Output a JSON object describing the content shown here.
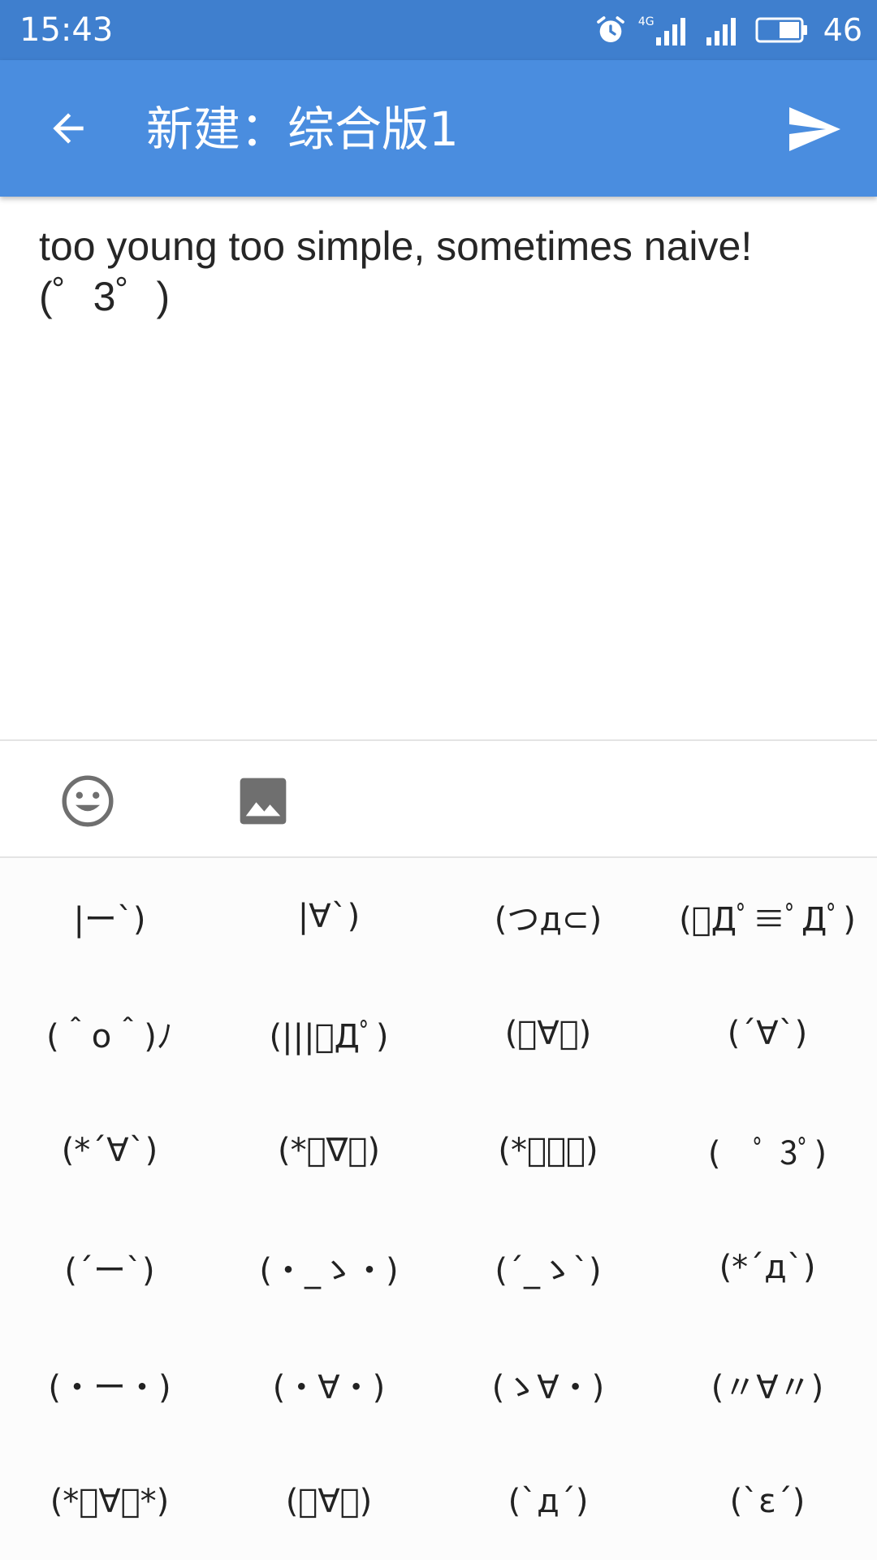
{
  "status_bar": {
    "time": "15:43",
    "network_label": "4G",
    "battery_level": "46",
    "icons": [
      "alarm-icon",
      "signal-icon",
      "signal-icon",
      "battery-icon"
    ]
  },
  "app_bar": {
    "title": "新建：综合版1",
    "back_icon": "arrow-back-icon",
    "send_icon": "send-icon"
  },
  "editor": {
    "lines": [
      "too young too simple, sometimes naive!",
      "(゜3゜)"
    ]
  },
  "toolbar": {
    "emoji_icon": "emoji-icon",
    "image_icon": "image-icon"
  },
  "kaomoji": [
    "|ー`)",
    "|∀`)",
    "(つд⊂)",
    "(ﾟДﾟ≡ﾟДﾟ)",
    "(＾o＾)ﾉ",
    "(|||ﾟДﾟ)",
    "(ﾟ∀ﾟ)",
    "(´∀`)",
    "(*´∀`)",
    "(*ﾟ∇ﾟ)",
    "(*ﾟーﾟ)",
    "(　ﾟ 3ﾟ)",
    "(´ー`)",
    "(・_ゝ・)",
    "(´_ゝ`)",
    "(*´д`)",
    "(・ー・)",
    "(・∀・)",
    "(ゝ∀・)",
    "(〃∀〃)",
    "(*ﾟ∀ﾟ*)",
    "(ﾟ∀。)",
    "(`д´)",
    "(`ε´)"
  ],
  "colors": {
    "status_bar": "#3f7fce",
    "app_bar": "#4a8ddf",
    "icon_gray": "#6f6f6f"
  }
}
